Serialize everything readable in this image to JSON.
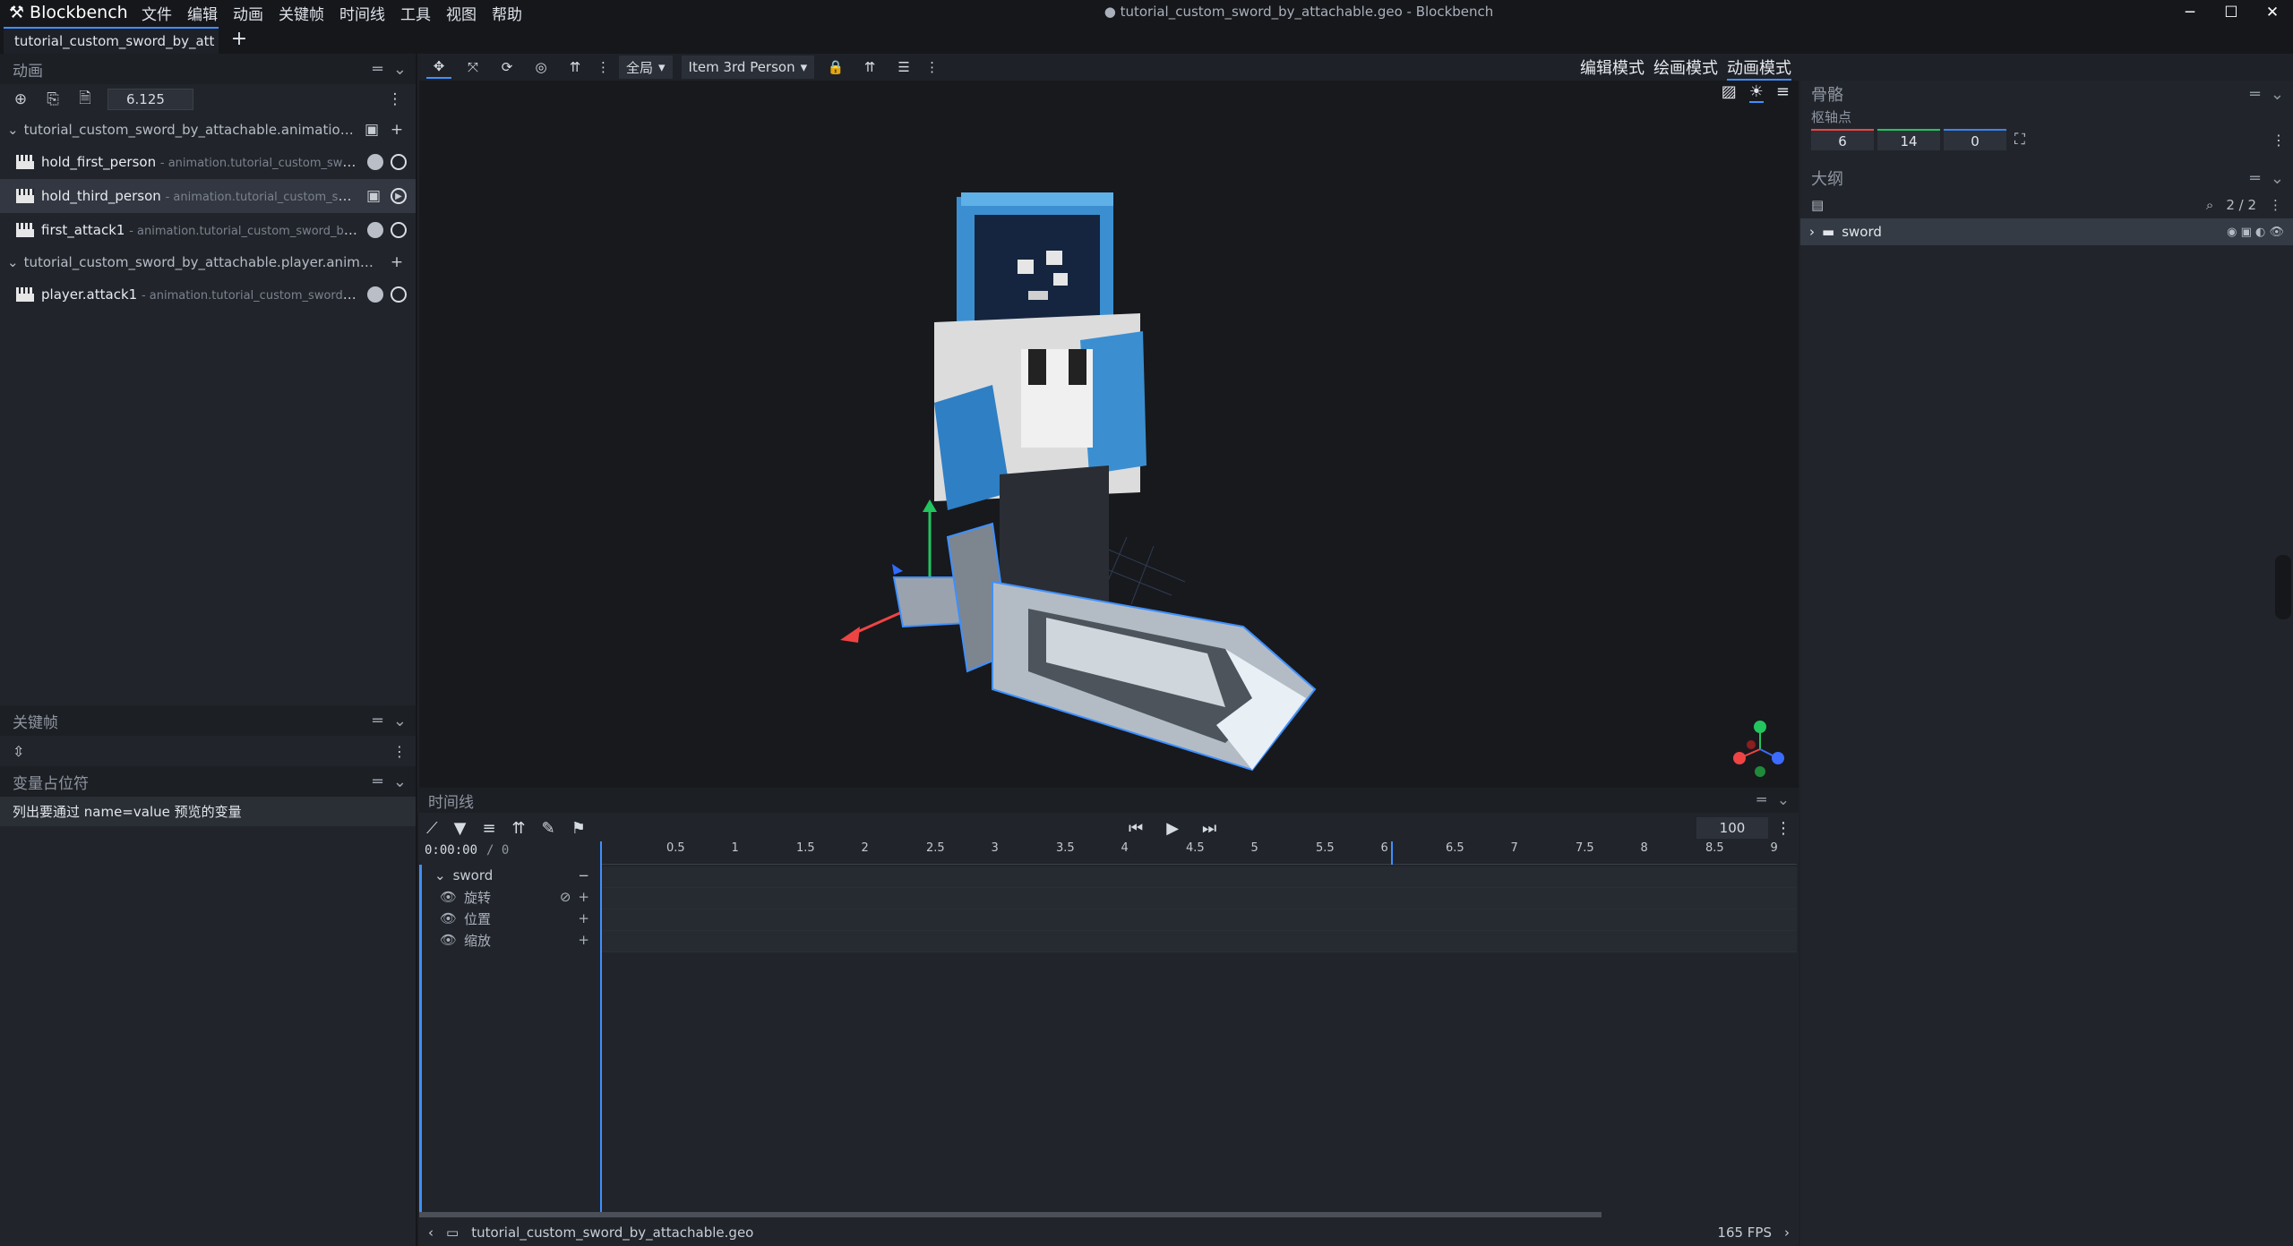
{
  "app": {
    "name": "Blockbench",
    "window_title": "● tutorial_custom_sword_by_attachable.geo - Blockbench"
  },
  "menu": [
    "文件",
    "编辑",
    "动画",
    "关键帧",
    "时间线",
    "工具",
    "视图",
    "帮助"
  ],
  "window_controls": [
    "─",
    "☐",
    "✕"
  ],
  "tab": {
    "label": "tutorial_custom_sword_by_att"
  },
  "left": {
    "animations": {
      "title": "动画",
      "speed": "6.125",
      "files": [
        {
          "name": "tutorial_custom_sword_by_attachable.animation.json",
          "items": [
            {
              "name": "hold_first_person",
              "sub": "- animation.tutorial_custom_sword_by_",
              "selected": false
            },
            {
              "name": "hold_third_person",
              "sub": "- animation.tutorial_custom_sword_by",
              "selected": true
            },
            {
              "name": "first_attack1",
              "sub": "- animation.tutorial_custom_sword_by_attac",
              "selected": false
            }
          ]
        },
        {
          "name": "tutorial_custom_sword_by_attachable.player.animation.json",
          "items": [
            {
              "name": "player.attack1",
              "sub": "- animation.tutorial_custom_sword_by_atta",
              "selected": false
            }
          ]
        }
      ]
    },
    "keyframes": {
      "title": "关键帧"
    },
    "variables": {
      "title": "变量占位符",
      "hint": "列出要通过 name=value 预览的变量"
    }
  },
  "viewport": {
    "toolbar": {
      "space": "全局",
      "preview": "Item 3rd Person"
    }
  },
  "modes": [
    "编辑模式",
    "绘画模式",
    "动画模式"
  ],
  "right": {
    "bone": {
      "title": "骨骼",
      "pivot_label": "枢轴点",
      "pivot": [
        "6",
        "14",
        "0"
      ]
    },
    "outline": {
      "title": "大纲",
      "count": "2 / 2",
      "items": [
        {
          "name": "sword"
        }
      ]
    }
  },
  "timeline": {
    "title": "时间线",
    "time": "0:00:00",
    "frame": "/ 0",
    "zoom": "100",
    "ticks": [
      "0.5",
      "1",
      "1.5",
      "2",
      "2.5",
      "3",
      "3.5",
      "4",
      "4.5",
      "5",
      "5.5",
      "6",
      "6.5",
      "7",
      "7.5",
      "8",
      "8.5",
      "9"
    ],
    "bone": "sword",
    "channels": [
      "旋转",
      "位置",
      "缩放"
    ]
  },
  "status": {
    "file": "tutorial_custom_sword_by_attachable.geo",
    "fps": "165 FPS"
  },
  "colors": {
    "accent": "#3e90ff",
    "bg": "#1e2127",
    "panel": "#21252b",
    "viewport": "#18191d"
  }
}
